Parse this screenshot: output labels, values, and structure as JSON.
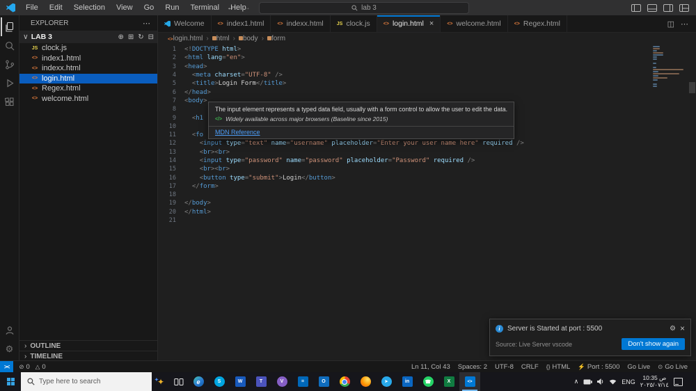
{
  "colors": {
    "accent": "#0078d4",
    "selection_blue": "#0a5dbe",
    "html_icon": "#e57e3e",
    "js_icon": "#e8d44d",
    "link_blue": "#4d9ef8",
    "notification_button": "#0078d4"
  },
  "title_bar": {
    "menus": [
      "File",
      "Edit",
      "Selection",
      "View",
      "Go",
      "Run",
      "Terminal",
      "Help"
    ],
    "search_value": "lab 3"
  },
  "explorer": {
    "header": "EXPLORER",
    "folder": "LAB 3",
    "files": [
      {
        "name": "clock.js",
        "type": "js"
      },
      {
        "name": "index1.html",
        "type": "html"
      },
      {
        "name": "indexx.html",
        "type": "html"
      },
      {
        "name": "login.html",
        "type": "html",
        "selected": true
      },
      {
        "name": "Regex.html",
        "type": "html"
      },
      {
        "name": "welcome.html",
        "type": "html"
      }
    ],
    "sections": [
      "OUTLINE",
      "TIMELINE"
    ]
  },
  "tabs": [
    {
      "label": "Welcome",
      "icon": "vscode"
    },
    {
      "label": "index1.html",
      "icon": "html"
    },
    {
      "label": "indexx.html",
      "icon": "html"
    },
    {
      "label": "clock.js",
      "icon": "js"
    },
    {
      "label": "login.html",
      "icon": "html",
      "active": true
    },
    {
      "label": "welcome.html",
      "icon": "html"
    },
    {
      "label": "Regex.html",
      "icon": "html"
    }
  ],
  "breadcrumb": [
    "login.html",
    "html",
    "body",
    "form"
  ],
  "editor": {
    "active_line": 11,
    "lines": [
      [
        [
          "p",
          "<!"
        ],
        [
          "tag",
          "DOCTYPE"
        ],
        [
          "w",
          " "
        ],
        [
          "attr",
          "html"
        ],
        [
          "p",
          ">"
        ]
      ],
      [
        [
          "p",
          "<"
        ],
        [
          "tag",
          "html"
        ],
        [
          "w",
          " "
        ],
        [
          "attr",
          "lang"
        ],
        [
          "p",
          "="
        ],
        [
          "str",
          "\"en\""
        ],
        [
          "p",
          ">"
        ]
      ],
      [
        [
          "p",
          "<"
        ],
        [
          "tag",
          "head"
        ],
        [
          "p",
          ">"
        ]
      ],
      [
        [
          "w",
          "  "
        ],
        [
          "p",
          "<"
        ],
        [
          "tag",
          "meta"
        ],
        [
          "w",
          " "
        ],
        [
          "attr",
          "charset"
        ],
        [
          "p",
          "="
        ],
        [
          "str",
          "\"UTF-8\""
        ],
        [
          "w",
          " "
        ],
        [
          "p",
          "/>"
        ]
      ],
      [
        [
          "w",
          "  "
        ],
        [
          "p",
          "<"
        ],
        [
          "tag",
          "title"
        ],
        [
          "p",
          ">"
        ],
        [
          "w",
          "Login Form"
        ],
        [
          "p",
          "</"
        ],
        [
          "tag",
          "title"
        ],
        [
          "p",
          ">"
        ]
      ],
      [
        [
          "p",
          "</"
        ],
        [
          "tag",
          "head"
        ],
        [
          "p",
          ">"
        ]
      ],
      [
        [
          "p",
          "<"
        ],
        [
          "tag",
          "body"
        ],
        [
          "p",
          ">"
        ]
      ],
      [],
      [
        [
          "w",
          "  "
        ],
        [
          "p",
          "<"
        ],
        [
          "tag",
          "h1"
        ]
      ],
      [],
      [
        [
          "w",
          "  "
        ],
        [
          "p",
          "<"
        ],
        [
          "tag",
          "fo"
        ]
      ],
      [
        [
          "w",
          "    "
        ],
        [
          "p",
          "<"
        ],
        [
          "tag",
          "input"
        ],
        [
          "w",
          " "
        ],
        [
          "attr",
          "type"
        ],
        [
          "p",
          "="
        ],
        [
          "str",
          "\"text\""
        ],
        [
          "w",
          " "
        ],
        [
          "attr",
          "name"
        ],
        [
          "p",
          "="
        ],
        [
          "str",
          "\"username\""
        ],
        [
          "w",
          " "
        ],
        [
          "attr",
          "placeholder"
        ],
        [
          "p",
          "="
        ],
        [
          "str",
          "\"Enter your user name here\""
        ],
        [
          "w",
          " "
        ],
        [
          "attr",
          "required"
        ],
        [
          "w",
          " "
        ],
        [
          "p",
          "/>"
        ]
      ],
      [
        [
          "w",
          "    "
        ],
        [
          "p",
          "<"
        ],
        [
          "tag",
          "br"
        ],
        [
          "p",
          "><"
        ],
        [
          "tag",
          "br"
        ],
        [
          "p",
          ">"
        ]
      ],
      [
        [
          "w",
          "    "
        ],
        [
          "p",
          "<"
        ],
        [
          "tag",
          "input"
        ],
        [
          "w",
          " "
        ],
        [
          "attr",
          "type"
        ],
        [
          "p",
          "="
        ],
        [
          "str",
          "\"password\""
        ],
        [
          "w",
          " "
        ],
        [
          "attr",
          "name"
        ],
        [
          "p",
          "="
        ],
        [
          "str",
          "\"password\""
        ],
        [
          "w",
          " "
        ],
        [
          "attr",
          "placeholder"
        ],
        [
          "p",
          "="
        ],
        [
          "str",
          "\"Password\""
        ],
        [
          "w",
          " "
        ],
        [
          "attr",
          "required"
        ],
        [
          "w",
          " "
        ],
        [
          "p",
          "/>"
        ]
      ],
      [
        [
          "w",
          "    "
        ],
        [
          "p",
          "<"
        ],
        [
          "tag",
          "br"
        ],
        [
          "p",
          "><"
        ],
        [
          "tag",
          "br"
        ],
        [
          "p",
          ">"
        ]
      ],
      [
        [
          "w",
          "    "
        ],
        [
          "p",
          "<"
        ],
        [
          "tag",
          "button"
        ],
        [
          "w",
          " "
        ],
        [
          "attr",
          "type"
        ],
        [
          "p",
          "="
        ],
        [
          "str",
          "\"submit\""
        ],
        [
          "p",
          ">"
        ],
        [
          "w",
          "Login"
        ],
        [
          "p",
          "</"
        ],
        [
          "tag",
          "button"
        ],
        [
          "p",
          ">"
        ]
      ],
      [
        [
          "w",
          "  "
        ],
        [
          "p",
          "</"
        ],
        [
          "tag",
          "form"
        ],
        [
          "p",
          ">"
        ]
      ],
      [],
      [
        [
          "p",
          "</"
        ],
        [
          "tag",
          "body"
        ],
        [
          "p",
          ">"
        ]
      ],
      [
        [
          "p",
          "</"
        ],
        [
          "tag",
          "html"
        ],
        [
          "p",
          ">"
        ]
      ],
      []
    ]
  },
  "tooltip": {
    "description": "The input element represents a typed data field, usually with a form control to allow the user to edit the data.",
    "baseline": "Widely available across major browsers (Baseline since 2015)",
    "link": "MDN Reference"
  },
  "notification": {
    "title": "Server is Started at port : 5500",
    "source": "Source: Live Server vscode",
    "button": "Don't show again"
  },
  "status_bar": {
    "left": [
      {
        "icon": "remote",
        "label": ""
      },
      {
        "icon": "error-circle",
        "label": "0"
      },
      {
        "icon": "warning-triangle",
        "label": "0"
      }
    ],
    "right": [
      {
        "label": "Ln 11, Col 43"
      },
      {
        "label": "Spaces: 2"
      },
      {
        "label": "UTF-8"
      },
      {
        "label": "CRLF"
      },
      {
        "icon": "braces",
        "label": "HTML"
      },
      {
        "icon": "plug",
        "label": "Port : 5500"
      },
      {
        "label": "Go Live"
      },
      {
        "icon": "broadcast",
        "label": "Go Live"
      }
    ]
  },
  "taskbar": {
    "search_placeholder": "Type here to search",
    "apps": [
      {
        "name": "edge",
        "glyph": "e",
        "color": "grad",
        "shape": "circle"
      },
      {
        "name": "skype",
        "glyph": "S",
        "color": "#00a5e0",
        "shape": "circle"
      },
      {
        "name": "word",
        "glyph": "W",
        "color": "#185abd",
        "shape": "square"
      },
      {
        "name": "teams",
        "glyph": "T",
        "color": "#4b53bc",
        "shape": "square"
      },
      {
        "name": "visual-studio",
        "glyph": "V",
        "color": "#865fc5",
        "shape": "circle"
      },
      {
        "name": "calculator",
        "glyph": "=",
        "color": "#0067b8",
        "shape": "square"
      },
      {
        "name": "outlook",
        "glyph": "O",
        "color": "#0f6cbd",
        "shape": "square"
      },
      {
        "name": "chrome",
        "glyph": "",
        "color": "grad",
        "shape": "circle"
      },
      {
        "name": "firefox",
        "glyph": "",
        "color": "grad",
        "shape": "circle"
      },
      {
        "name": "telegram",
        "glyph": "➤",
        "color": "#29a9eb",
        "shape": "circle"
      },
      {
        "name": "linkedin",
        "glyph": "in",
        "color": "#0a66c2",
        "shape": "square"
      },
      {
        "name": "whatsapp",
        "glyph": "☎",
        "color": "#25d366",
        "shape": "circle"
      },
      {
        "name": "excel",
        "glyph": "X",
        "color": "#107c41",
        "shape": "square"
      },
      {
        "name": "vscode",
        "glyph": "<>",
        "color": "#0078d4",
        "shape": "square",
        "active": true
      }
    ],
    "tray": {
      "lang": "ENG",
      "time": "10:35 ص",
      "date": "٢٠٢٥/٠٧/١٤"
    }
  }
}
